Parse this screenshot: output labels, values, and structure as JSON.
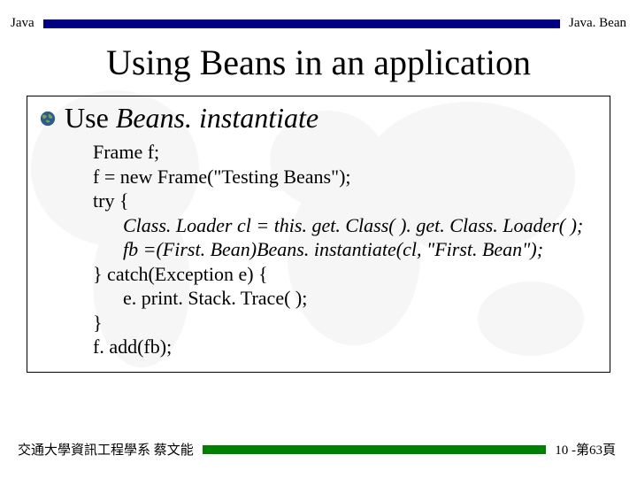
{
  "header": {
    "left": "Java",
    "right": "Java. Bean"
  },
  "title": "Using Beans in an application",
  "bullet": {
    "use": "Use ",
    "instantiate": "Beans. instantiate"
  },
  "code": {
    "l1": "Frame f;",
    "l2": "f = new Frame(\"Testing Beans\");",
    "l3": "try {",
    "l4": "Class. Loader cl = this. get. Class( ). get. Class. Loader( );",
    "l5": "fb =(First. Bean)Beans. instantiate(cl, \"First. Bean\");",
    "l6": "} catch(Exception e) {",
    "l7": "e. print. Stack. Trace( );",
    "l8": "}",
    "l9": "f. add(fb);"
  },
  "footer": {
    "left": "交通大學資訊工程學系 蔡文能",
    "right": "10 -第63頁"
  },
  "colors": {
    "header_bar": "#000080",
    "footer_bar": "#008000"
  }
}
